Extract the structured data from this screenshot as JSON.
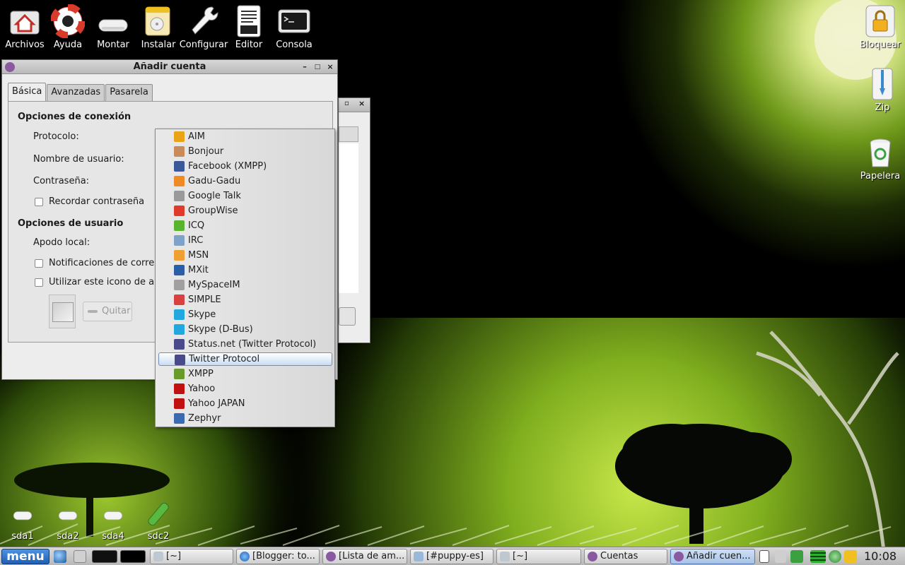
{
  "desktop": {
    "top_icons": [
      {
        "label": "Archivos",
        "icon": "home-folder-icon"
      },
      {
        "label": "Ayuda",
        "icon": "lifebuoy-icon"
      },
      {
        "label": "Montar",
        "icon": "drive-icon"
      },
      {
        "label": "Instalar",
        "icon": "install-package-icon"
      },
      {
        "label": "Configurar",
        "icon": "wrench-icon"
      },
      {
        "label": "Editor",
        "icon": "text-editor-icon"
      },
      {
        "label": "Consola",
        "icon": "terminal-icon"
      }
    ],
    "right_icons": [
      {
        "label": "Bloquear",
        "icon": "lock-icon"
      },
      {
        "label": "Zip",
        "icon": "zip-icon"
      },
      {
        "label": "Papelera",
        "icon": "trash-icon"
      }
    ],
    "drive_icons": [
      {
        "label": "sda1"
      },
      {
        "label": "sda2"
      },
      {
        "label": "sda4"
      },
      {
        "label": "sdc2"
      }
    ]
  },
  "dialog": {
    "title": "Añadir cuenta",
    "tabs": [
      {
        "label": "Básica",
        "active": true
      },
      {
        "label": "Avanzadas",
        "active": false
      },
      {
        "label": "Pasarela",
        "active": false
      }
    ],
    "connection_section": "Opciones de conexión",
    "protocol_label": "Protocolo:",
    "username_label": "Nombre de usuario:",
    "password_label": "Contraseña:",
    "remember_password": "Recordar contraseña",
    "user_section": "Opciones de usuario",
    "local_alias_label": "Apodo local:",
    "mail_notifications": "Notificaciones de corre",
    "use_icon": "Utilizar este icono de ar",
    "remove_button": "Quitar"
  },
  "protocol_menu": {
    "selected": "Twitter Protocol",
    "items": [
      {
        "label": "AIM",
        "icon": "aim-icon",
        "color": "#e8a317"
      },
      {
        "label": "Bonjour",
        "icon": "bonjour-icon",
        "color": "#c98b5a"
      },
      {
        "label": "Facebook (XMPP)",
        "icon": "facebook-icon",
        "color": "#3b5998"
      },
      {
        "label": "Gadu-Gadu",
        "icon": "gadu-gadu-icon",
        "color": "#f08a24"
      },
      {
        "label": "Google Talk",
        "icon": "google-talk-icon",
        "color": "#9a9a9a"
      },
      {
        "label": "GroupWise",
        "icon": "groupwise-icon",
        "color": "#e03a2a"
      },
      {
        "label": "ICQ",
        "icon": "icq-icon",
        "color": "#58b32e"
      },
      {
        "label": "IRC",
        "icon": "irc-icon",
        "color": "#7fa2c9"
      },
      {
        "label": "MSN",
        "icon": "msn-icon",
        "color": "#f0a030"
      },
      {
        "label": "MXit",
        "icon": "mxit-icon",
        "color": "#2a5fa8"
      },
      {
        "label": "MySpaceIM",
        "icon": "myspaceim-icon",
        "color": "#a0a0a0"
      },
      {
        "label": "SIMPLE",
        "icon": "simple-icon",
        "color": "#d94040"
      },
      {
        "label": "Skype",
        "icon": "skype-icon",
        "color": "#22a8e0"
      },
      {
        "label": "Skype (D-Bus)",
        "icon": "skype-dbus-icon",
        "color": "#22a8e0"
      },
      {
        "label": "Status.net (Twitter Protocol)",
        "icon": "statusnet-icon",
        "color": "#4a4a8a"
      },
      {
        "label": "Twitter Protocol",
        "icon": "twitter-icon",
        "color": "#4a4a8a"
      },
      {
        "label": "XMPP",
        "icon": "xmpp-icon",
        "color": "#6a9a2a"
      },
      {
        "label": "Yahoo",
        "icon": "yahoo-icon",
        "color": "#c01010"
      },
      {
        "label": "Yahoo JAPAN",
        "icon": "yahoo-japan-icon",
        "color": "#c01010"
      },
      {
        "label": "Zephyr",
        "icon": "zephyr-icon",
        "color": "#3a6ab0"
      }
    ]
  },
  "taskbar": {
    "menu_label": "menu",
    "tasks": [
      {
        "label": "[~]"
      },
      {
        "label": "[Blogger: to..."
      },
      {
        "label": "[Lista de am..."
      },
      {
        "label": "[#puppy-es]"
      },
      {
        "label": "[~]"
      },
      {
        "label": "Cuentas"
      },
      {
        "label": "Añadir cuen..."
      }
    ],
    "clock": "10:08"
  },
  "colors": {
    "accent_green": "#a6d23a",
    "menu_blue": "#1f5fb6",
    "selection_border": "#6f8fb9"
  }
}
